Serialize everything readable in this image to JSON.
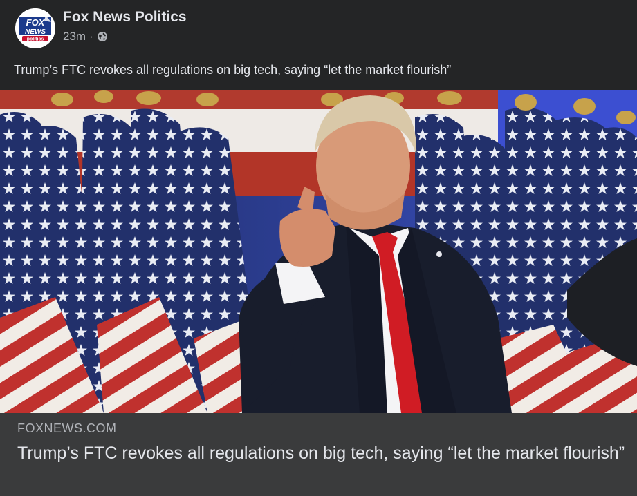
{
  "post": {
    "page_name": "Fox News Politics",
    "timestamp": "23m",
    "separator": "·",
    "audience_icon": "globe-icon",
    "caption": "Trump’s FTC revokes all regulations on big tech, saying “let the market flourish”"
  },
  "avatar": {
    "logo_top": "FOX",
    "logo_middle": "NEWS",
    "logo_bottom": "politics"
  },
  "link_preview": {
    "domain": "FOXNEWS.COM",
    "title": "Trump’s FTC revokes all regulations on big tech, saying “let the market flourish”"
  },
  "colors": {
    "background": "#242526",
    "footer": "#3a3b3c",
    "primary_text": "#e4e6eb",
    "secondary_text": "#b0b3b8",
    "flag_red": "#c0312e",
    "flag_blue": "#22306b",
    "tie_red": "#d01c24"
  }
}
